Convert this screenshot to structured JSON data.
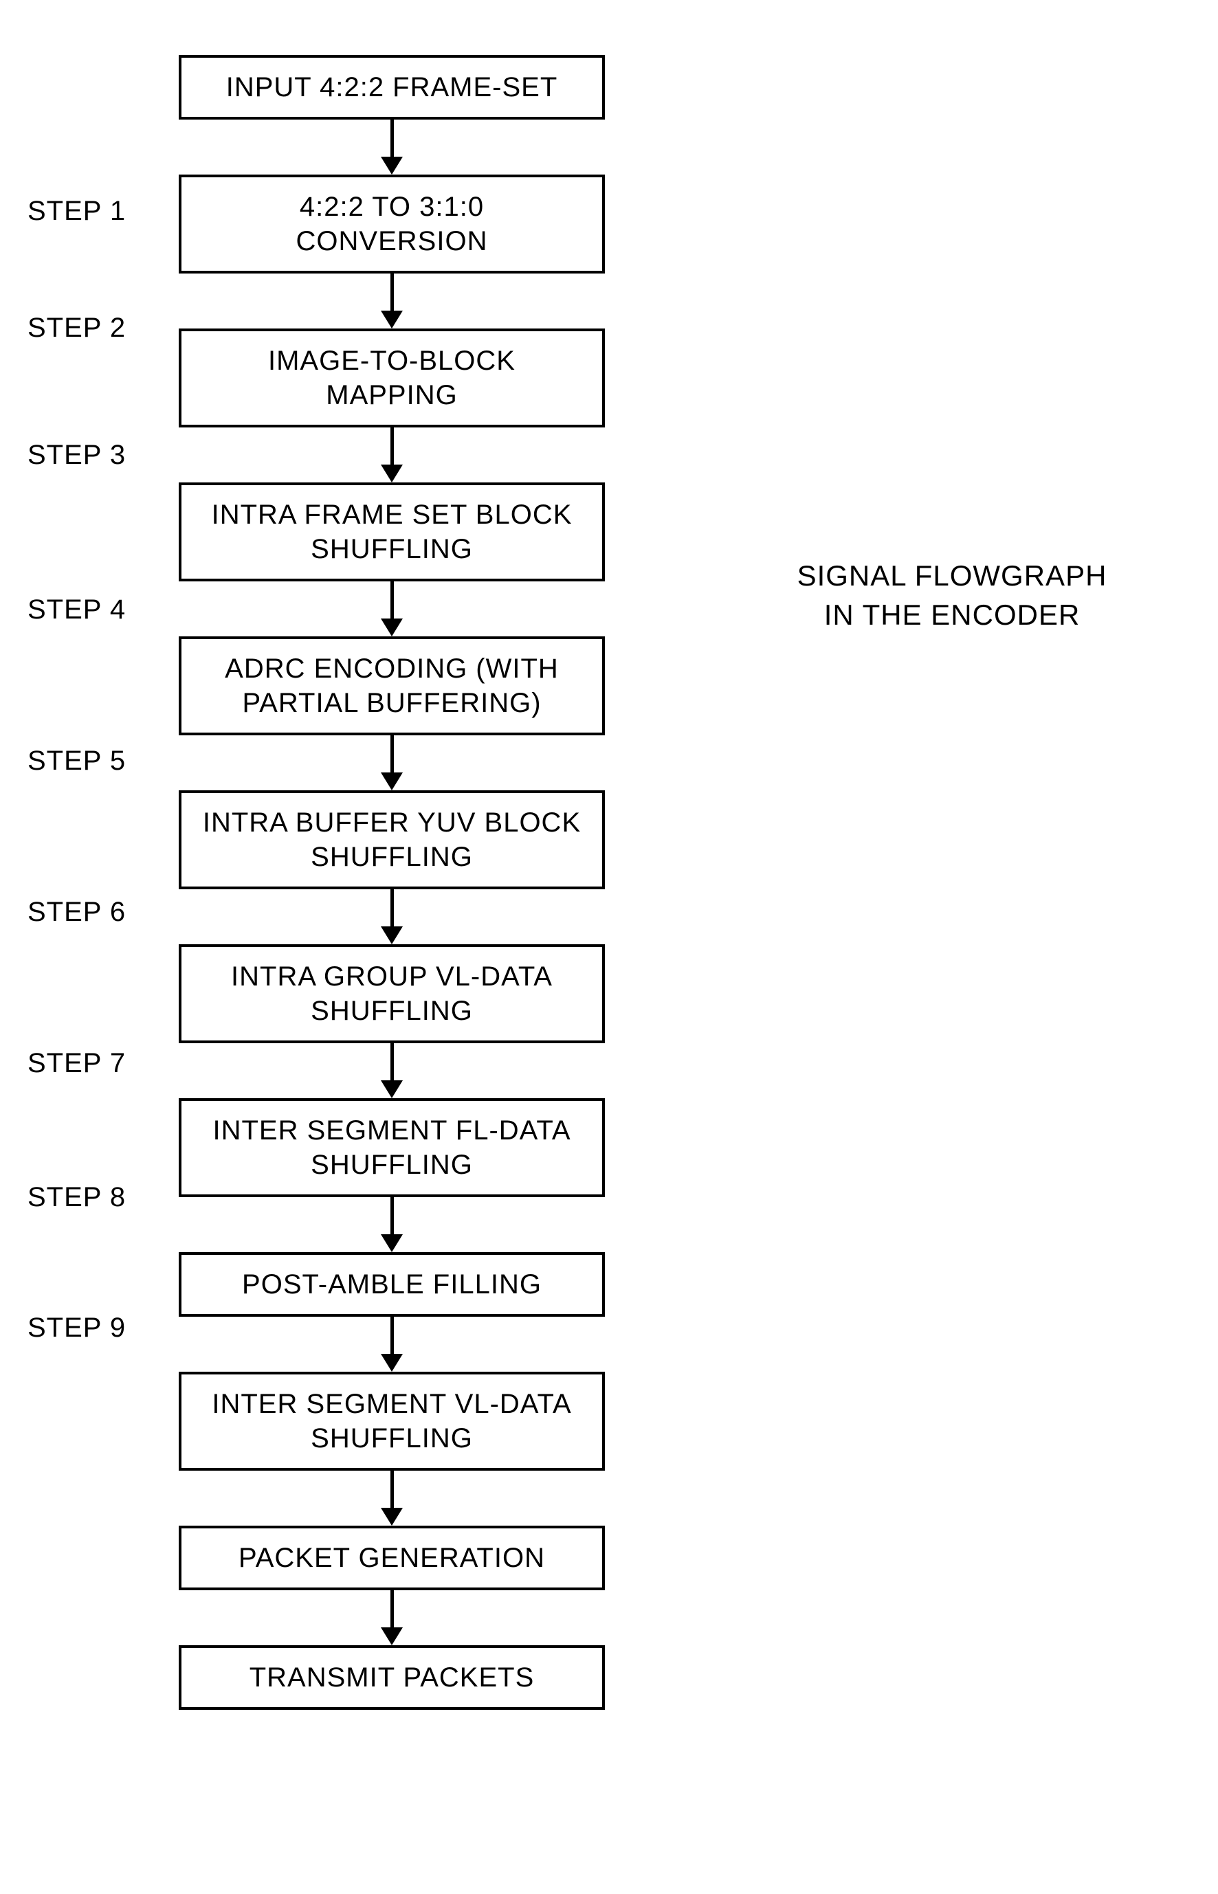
{
  "side_title_line1": "SIGNAL FLOWGRAPH",
  "side_title_line2": "IN THE ENCODER",
  "boxes": {
    "b0": "INPUT 4:2:2 FRAME-SET",
    "b1": "4:2:2 TO 3:1:0 CONVERSION",
    "b2": "IMAGE-TO-BLOCK MAPPING",
    "b3_line1": "INTRA FRAME SET BLOCK",
    "b3_line2": "SHUFFLING",
    "b4_line1": "ADRC ENCODING (WITH",
    "b4_line2": "PARTIAL BUFFERING)",
    "b5_line1": "INTRA BUFFER YUV BLOCK",
    "b5_line2": "SHUFFLING",
    "b6_line1": "INTRA GROUP VL-DATA",
    "b6_line2": "SHUFFLING",
    "b7_line1": "INTER SEGMENT FL-DATA",
    "b7_line2": "SHUFFLING",
    "b8": "POST-AMBLE FILLING",
    "b9_line1": "INTER SEGMENT VL-DATA",
    "b9_line2": "SHUFFLING",
    "b10": "PACKET GENERATION",
    "b11": "TRANSMIT PACKETS"
  },
  "steps": {
    "s1": "STEP 1",
    "s2": "STEP 2",
    "s3": "STEP 3",
    "s4": "STEP 4",
    "s5": "STEP 5",
    "s6": "STEP 6",
    "s7": "STEP 7",
    "s8": "STEP 8",
    "s9": "STEP 9"
  }
}
